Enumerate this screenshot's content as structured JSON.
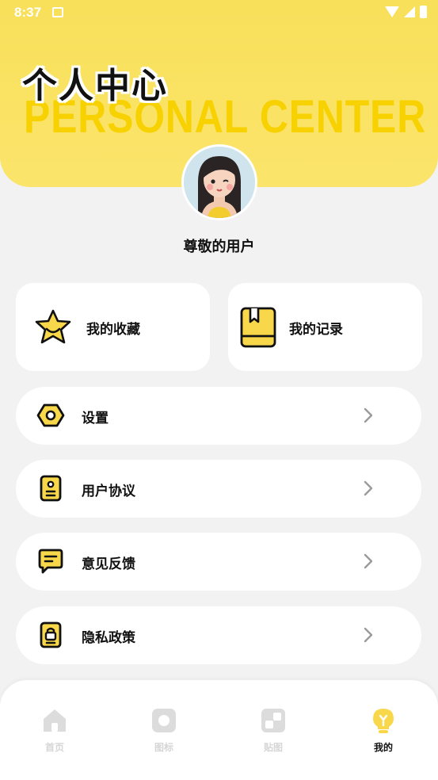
{
  "status_bar": {
    "time": "8:37"
  },
  "header": {
    "title_cn": "个人中心",
    "title_en": "PERSONAL CENTER"
  },
  "user": {
    "name": "尊敬的用户"
  },
  "cards": [
    {
      "label": "我的收藏",
      "icon": "star-icon"
    },
    {
      "label": "我的记录",
      "icon": "book-icon"
    }
  ],
  "menu": [
    {
      "label": "设置",
      "icon": "gear-icon"
    },
    {
      "label": "用户协议",
      "icon": "agreement-icon"
    },
    {
      "label": "意见反馈",
      "icon": "feedback-icon"
    },
    {
      "label": "隐私政策",
      "icon": "privacy-lock-icon"
    }
  ],
  "nav": [
    {
      "label": "首页",
      "icon": "home-icon"
    },
    {
      "label": "图标",
      "icon": "icon-grid-icon"
    },
    {
      "label": "贴图",
      "icon": "sticker-icon"
    },
    {
      "label": "我的",
      "icon": "lightbulb-icon",
      "active": true
    }
  ],
  "colors": {
    "accent": "#f8d84a",
    "header_bg": "#fbe46b",
    "text": "#111111",
    "inactive": "#d6d6d6"
  }
}
